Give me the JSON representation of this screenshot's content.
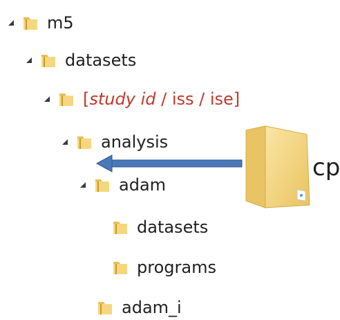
{
  "tree": {
    "items": [
      {
        "label": "m5",
        "expanded": true
      },
      {
        "label": "datasets",
        "expanded": true
      },
      {
        "label_open": "[",
        "label_italic": "study id",
        "label_rest": " / iss / ise",
        "label_close": "]",
        "expanded": true
      },
      {
        "label": "analysis",
        "expanded": true
      },
      {
        "label": "adam",
        "expanded": true
      },
      {
        "label": "datasets",
        "expanded": false
      },
      {
        "label": "programs",
        "expanded": false
      },
      {
        "label": "adam_i",
        "expanded": false
      }
    ]
  },
  "overlay": {
    "copy_label": "cp",
    "arrow_color": "#4a78b8",
    "folder_color": "#f2d27a"
  }
}
